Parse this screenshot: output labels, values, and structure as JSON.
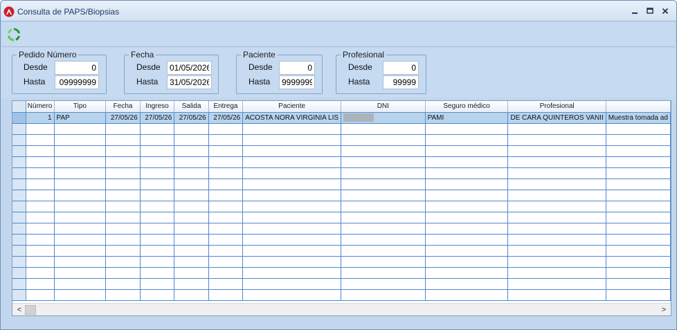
{
  "window": {
    "title": "Consulta de PAPS/Biopsias",
    "minimize_glyph": "_",
    "maximize_glyph": "▭",
    "close_glyph": "✕"
  },
  "toolbar": {
    "refresh_icon": "refresh-icon"
  },
  "filters": {
    "pedido": {
      "legend": "Pedido Número",
      "desde_label": "Desde",
      "desde_value": "0",
      "hasta_label": "Hasta",
      "hasta_value": "09999999"
    },
    "fecha": {
      "legend": "Fecha",
      "desde_label": "Desde",
      "desde_value": "01/05/2026",
      "hasta_label": "Hasta",
      "hasta_value": "31/05/2026"
    },
    "paciente": {
      "legend": "Paciente",
      "desde_label": "Desde",
      "desde_value": "0",
      "hasta_label": "Hasta",
      "hasta_value": "9999999"
    },
    "profesional": {
      "legend": "Profesional",
      "desde_label": "Desde",
      "desde_value": "0",
      "hasta_label": "Hasta",
      "hasta_value": "99999"
    }
  },
  "grid": {
    "columns": [
      "Número",
      "Tipo",
      "Fecha",
      "Ingreso",
      "Salida",
      "Entrega",
      "Paciente",
      "DNI",
      "Seguro médico",
      "Profesional",
      ""
    ],
    "rows": [
      {
        "numero": "1",
        "tipo": "PAP",
        "fecha": "27/05/26",
        "ingreso": "27/05/26",
        "salida": "27/05/26",
        "entrega": "27/05/26",
        "paciente": "ACOSTA NORA VIRGINIA LIS",
        "dni": "",
        "seguro": "PAMI",
        "profesional": "DE CARA QUINTEROS VANII",
        "observacion": "Muestra tomada ad"
      }
    ],
    "scroll_left": "<",
    "scroll_right": ">"
  },
  "colors": {
    "window_bg": "#c2d7ee",
    "grid_line": "#4f86d1",
    "selected_row": "#b7d4ec"
  }
}
